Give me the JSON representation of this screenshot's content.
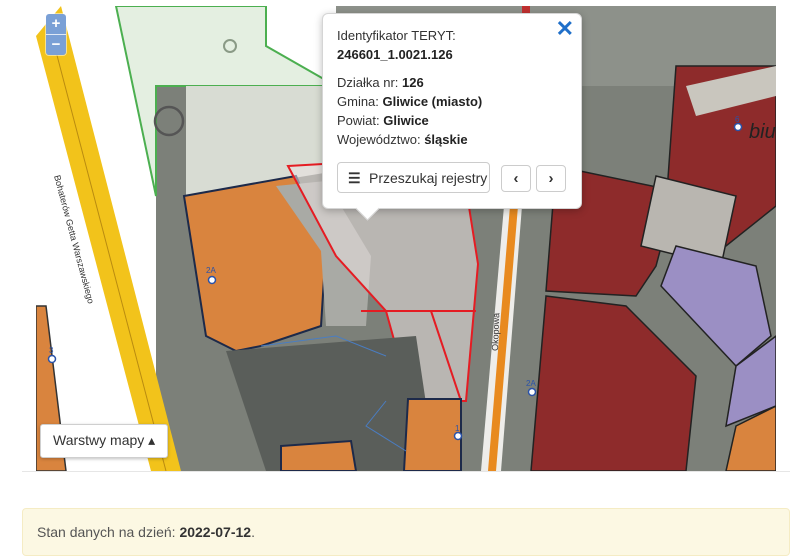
{
  "map": {
    "zoom_in": "+",
    "zoom_out": "−",
    "layers_button": "Warstwy mapy ▴",
    "street_labels": [
      "Bohaterów Getta Warszawskiego",
      "Okopowa"
    ],
    "parcel_labels": [
      "2A",
      "2A",
      "1",
      "3",
      "6"
    ],
    "place_label": "biu"
  },
  "popup": {
    "teryt_label": "Identyfikator TERYT:",
    "teryt_value": "246601_1.0021.126",
    "parcel_label": "Działka nr:",
    "parcel_value": "126",
    "gmina_label": "Gmina:",
    "gmina_value": "Gliwice (miasto)",
    "powiat_label": "Powiat:",
    "powiat_value": "Gliwice",
    "woj_label": "Województwo:",
    "woj_value": "śląskie",
    "search_button": "Przeszukaj rejestry",
    "prev_label": "‹",
    "next_label": "›",
    "close_label": "✕"
  },
  "status": {
    "label": "Stan danych na dzień:",
    "date": "2022-07-12"
  },
  "colors": {
    "orange_parcel": "#d9843e",
    "red_parcel": "#8e2b2b",
    "purple_parcel": "#9b8fc4",
    "selected_outline": "#e51c23",
    "road_yellow": "#f2c31b"
  }
}
